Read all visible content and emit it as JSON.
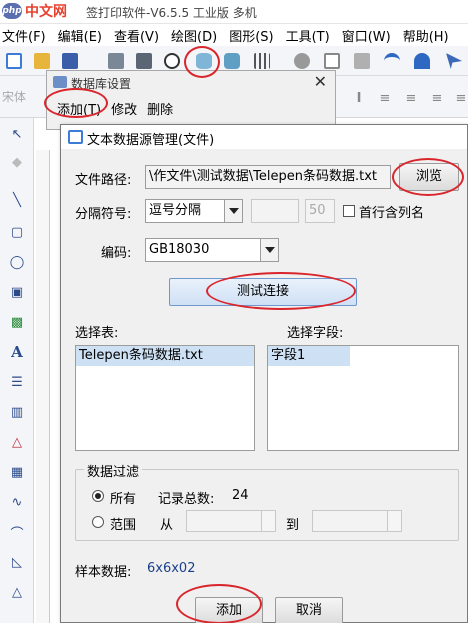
{
  "watermark": {
    "logo": "php",
    "text": "中文网"
  },
  "app": {
    "title": "签打印软件-V6.5.5 工业版 多机"
  },
  "menubar": {
    "items": [
      "文件(F)",
      "编辑(E)",
      "查看(V)",
      "绘图(D)",
      "图形(S)",
      "工具(T)",
      "窗口(W)",
      "帮助(H)"
    ]
  },
  "toolbar2": {
    "label": "宋体"
  },
  "sidebar": {
    "text_tool": "A"
  },
  "db_dialog": {
    "title": "数据库设置",
    "close": "✕",
    "menu": {
      "add": "添加(T)",
      "edit": "修改",
      "delete": "删除"
    }
  },
  "ds_dialog": {
    "title": "文本数据源管理(文件)",
    "file_path_label": "文件路径:",
    "file_path_value": "\\作文件\\测试数据\\Telepen条码数据.txt",
    "browse_button": "浏览",
    "separator_label": "分隔符号:",
    "separator_value": "逗号分隔",
    "separator_extra": "50",
    "first_row_label": "首行含列名",
    "encoding_label": "编码:",
    "encoding_value": "GB18030",
    "test_button": "测试连接",
    "table_label": "选择表:",
    "field_label": "选择字段:",
    "tables": [
      "Telepen条码数据.txt"
    ],
    "fields": [
      "字段1"
    ],
    "filter": {
      "title": "数据过滤",
      "all_label": "所有",
      "record_count_label": "记录总数:",
      "record_count": "24",
      "range_label": "范围",
      "from_label": "从",
      "to_label": "到"
    },
    "sample_label": "样本数据:",
    "sample_value": "6x6x02",
    "add_button": "添加",
    "cancel_button": "取消"
  },
  "colors": {
    "annotation": "#d9262c",
    "selection": "#cde0f4",
    "accent": "#3c7bd6"
  }
}
